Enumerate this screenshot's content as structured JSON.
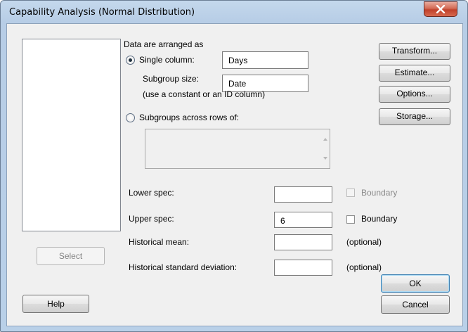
{
  "window": {
    "title": "Capability Analysis (Normal Distribution)"
  },
  "close_label": "X",
  "data_arranged": {
    "heading": "Data are arranged as",
    "single_column_label": "Single column:",
    "single_column_value": "Days",
    "subgroup_size_label": "Subgroup size:",
    "subgroup_size_value": "Date",
    "subgroup_hint": "(use a constant or an ID column)",
    "across_rows_label": "Subgroups across rows of:",
    "across_rows_value": ""
  },
  "specs": {
    "lower_label": "Lower spec:",
    "lower_value": "",
    "lower_boundary": "Boundary",
    "upper_label": "Upper spec:",
    "upper_value": "6",
    "upper_boundary": "Boundary",
    "hist_mean_label": "Historical mean:",
    "hist_mean_value": "",
    "hist_mean_note": "(optional)",
    "hist_sd_label": "Historical standard deviation:",
    "hist_sd_value": "",
    "hist_sd_note": "(optional)"
  },
  "buttons": {
    "transform": "Transform...",
    "estimate": "Estimate...",
    "options": "Options...",
    "storage": "Storage...",
    "select": "Select",
    "help": "Help",
    "ok": "OK",
    "cancel": "Cancel"
  }
}
